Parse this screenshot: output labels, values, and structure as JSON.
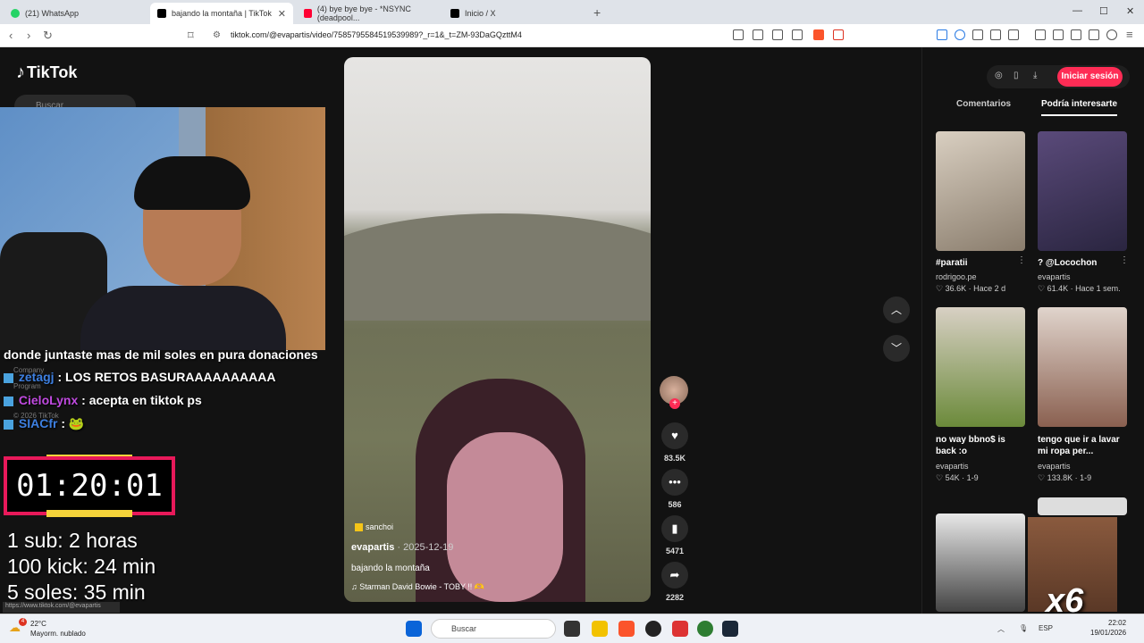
{
  "browser": {
    "tabs": [
      {
        "title": "(21) WhatsApp",
        "color": "#25d366"
      },
      {
        "title": "bajando la montaña | TikTok",
        "color": "#000000"
      },
      {
        "title": "(4) bye bye bye - *NSYNC (deadpool...",
        "color": "#ff0033"
      },
      {
        "title": "Inicio / X",
        "color": "#000000"
      }
    ],
    "url": "tiktok.com/@evapartis/video/7585795584519539989?_r=1&_t=ZM-93DaGQzttM4"
  },
  "tiktok": {
    "logo": "TikTok",
    "search_placeholder": "Buscar",
    "sidebar_ghost": [
      "Company",
      "Program",
      "© 2026 TikTok"
    ],
    "video": {
      "tag": "sanchoi",
      "author": "evapartis",
      "date": "· 2025-12-19",
      "description": "bajando la montaña",
      "music": "♫  Starman David Bowie - TOBY !! 🫶"
    },
    "actions": {
      "likes": "83.5K",
      "comments": "586",
      "saves": "5471",
      "shares": "2282"
    },
    "panel": {
      "login": "Iniciar sesión",
      "tab_comments": "Comentarios",
      "tab_suggested": "Podría interesarte",
      "cards": [
        {
          "title": "#paratii",
          "user": "rodrigoo.pe",
          "meta": "♡ 36.6K · Hace 2 d"
        },
        {
          "title": "? @Locochon",
          "user": "evapartis",
          "meta": "♡ 61.4K · Hace 1 sem."
        },
        {
          "title": "no way bbno$ is back :o",
          "user": "evapartis",
          "meta": "♡ 54K · 1-9"
        },
        {
          "title": "tengo que ir a lavar mi ropa per...",
          "user": "evapartis",
          "meta": "♡ 133.8K · 1-9"
        }
      ]
    }
  },
  "overlay": {
    "chat": [
      {
        "user": "",
        "message": "donde juntaste mas de mil soles en pura donaciones"
      },
      {
        "user": "zetagj",
        "message": ": LOS RETOS BASURAAAAAAAAAA"
      },
      {
        "user": "CieloLynx",
        "message": ": acepta en tiktok ps"
      },
      {
        "user": "SIACfr",
        "message": ": 🐸"
      }
    ],
    "timer": "01:20:01",
    "stats": [
      "1 sub: 2 horas",
      "100 kick: 24 min",
      "5 soles: 35 min"
    ],
    "meme_label": "x6"
  },
  "statusbar": {
    "url": "https://www.tiktok.com/@evapartis"
  },
  "taskbar": {
    "temp": "22°C",
    "weather": "Mayorm. nublado",
    "notif": "4",
    "search": "Buscar",
    "lang": "ESP",
    "time": "22:02",
    "date": "19/01/2026"
  }
}
